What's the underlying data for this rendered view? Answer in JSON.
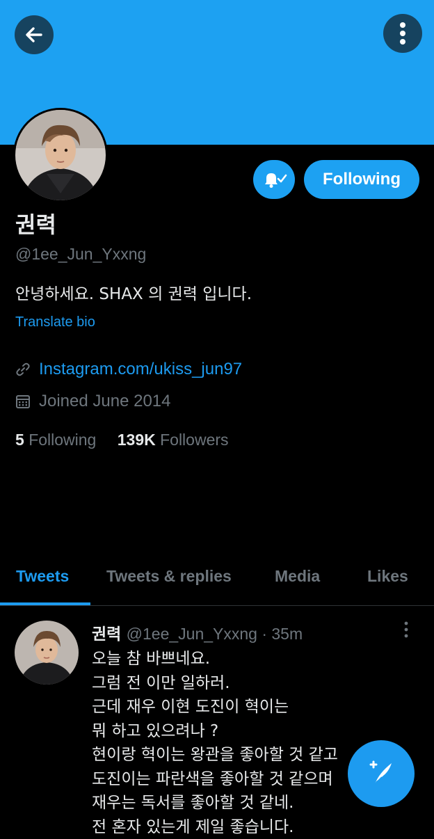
{
  "profile": {
    "name": "권력",
    "handle": "@1ee_Jun_Yxxng",
    "bio": "안녕하세요. SHAX 의 권력 입니다.",
    "translate_label": "Translate bio",
    "link": "Instagram.com/ukiss_jun97",
    "joined": "Joined June 2014",
    "following_count": "5",
    "following_label": "Following",
    "followers_count": "139K",
    "followers_label": "Followers",
    "follow_button_label": "Following"
  },
  "tabs": [
    {
      "label": "Tweets",
      "active": true
    },
    {
      "label": "Tweets & replies",
      "active": false
    },
    {
      "label": "Media",
      "active": false
    },
    {
      "label": "Likes",
      "active": false
    }
  ],
  "tweet": {
    "name": "권력",
    "meta": "@1ee_Jun_Yxxng · 35m",
    "lines": [
      "오늘 참 바쁘네요.",
      "그럼 전 이만 일하러.",
      "근데 재우 이현 도진이 혁이는",
      "뭐 하고 있으려나 ?",
      "현이랑 혁이는 왕관을 좋아할 것 같고",
      "도진이는 파란색을 좋아할 것 같으며",
      "재우는 독서를 좋아할 것 같네.",
      "전 혼자 있는게 제일 좋습니다."
    ]
  },
  "colors": {
    "accent": "#1da1f2",
    "background": "#000000",
    "muted_text": "#6e767d",
    "link": "#1d9bf0"
  },
  "icons": [
    "back-arrow-icon",
    "more-vertical-icon",
    "bell-check-icon",
    "link-icon",
    "calendar-icon",
    "compose-tweet-icon"
  ]
}
